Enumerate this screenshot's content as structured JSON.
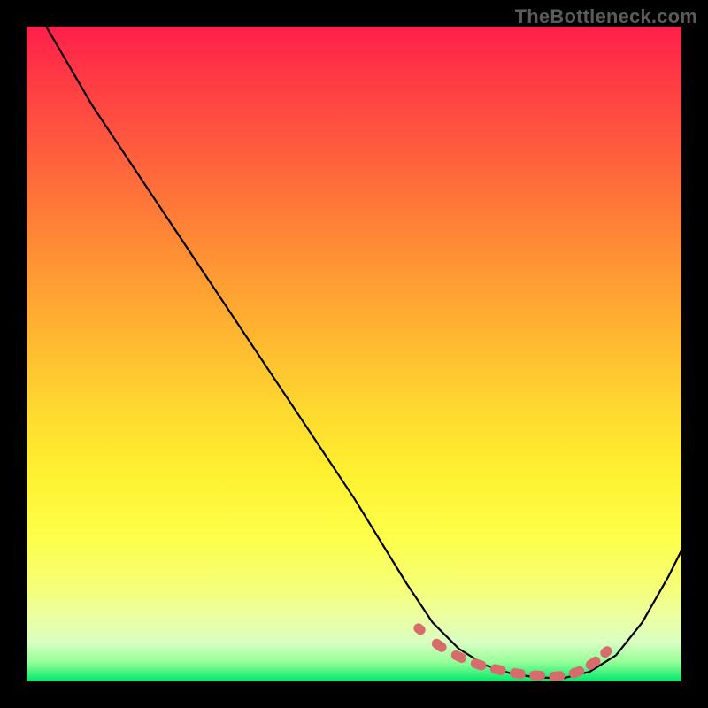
{
  "watermark": {
    "text": "TheBottleneck.com"
  },
  "chart_data": {
    "type": "line",
    "title": "",
    "xlabel": "",
    "ylabel": "",
    "xlim": [
      0,
      100
    ],
    "ylim": [
      0,
      100
    ],
    "grid": false,
    "legend": false,
    "series": [
      {
        "name": "curve",
        "color": "#000000",
        "x": [
          3,
          10,
          20,
          30,
          40,
          50,
          58,
          62,
          66,
          70,
          74,
          78,
          82,
          86,
          90,
          94,
          98,
          100
        ],
        "values": [
          100,
          88,
          73,
          58,
          43,
          28,
          15,
          9,
          5,
          2.5,
          1.2,
          0.6,
          0.5,
          1.5,
          4,
          9,
          16,
          20
        ]
      }
    ],
    "markers": [
      {
        "name": "bottom-band",
        "color": "#d86b6b",
        "shape": "rounded-dash",
        "x": [
          60,
          63,
          66,
          69,
          72,
          75,
          78,
          81,
          84,
          86.5,
          88.5
        ],
        "values": [
          8,
          5.5,
          3.8,
          2.6,
          1.8,
          1.2,
          0.9,
          0.8,
          1.4,
          2.8,
          4.5
        ]
      }
    ],
    "background_gradient": {
      "type": "vertical",
      "stops": [
        {
          "pos": 0,
          "color": "#ff1f4b"
        },
        {
          "pos": 28,
          "color": "#ff7a38"
        },
        {
          "pos": 58,
          "color": "#ffd730"
        },
        {
          "pos": 85,
          "color": "#f6ff73"
        },
        {
          "pos": 100,
          "color": "#00e86a"
        }
      ]
    }
  }
}
